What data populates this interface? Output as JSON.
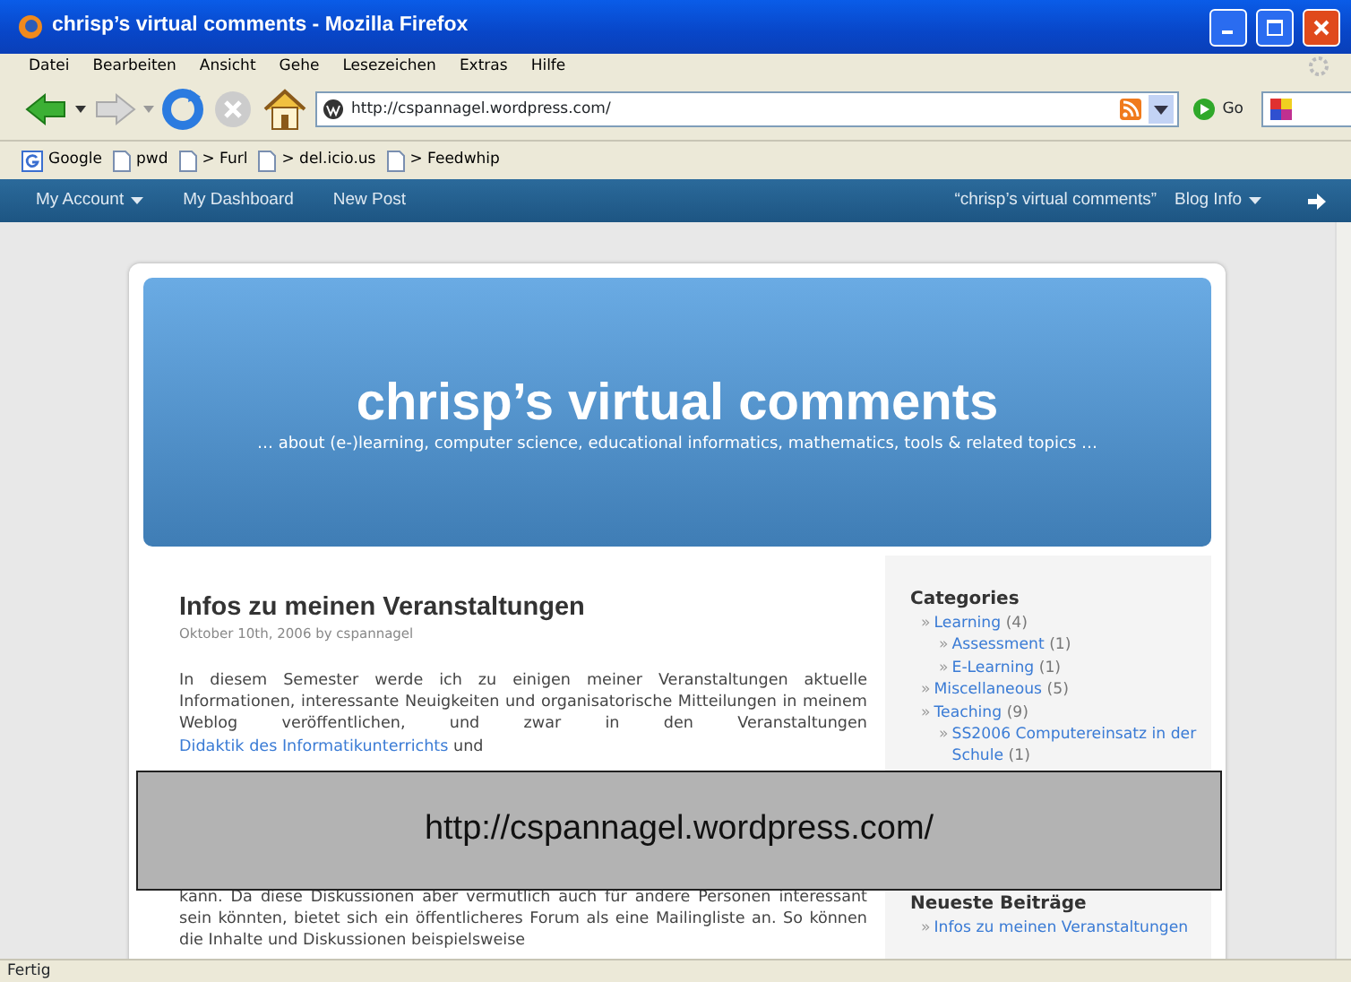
{
  "window": {
    "title": "chrisp’s virtual comments - Mozilla Firefox"
  },
  "menu": [
    "Datei",
    "Bearbeiten",
    "Ansicht",
    "Gehe",
    "Lesezeichen",
    "Extras",
    "Hilfe"
  ],
  "navigation": {
    "address": "http://cspannagel.wordpress.com/",
    "go_label": "Go"
  },
  "bookmarks": [
    {
      "label": "Google",
      "kind": "google"
    },
    {
      "label": "pwd",
      "kind": "page"
    },
    {
      "label": "> Furl",
      "kind": "page"
    },
    {
      "label": "> del.icio.us",
      "kind": "page"
    },
    {
      "label": "> Feedwhip",
      "kind": "page"
    }
  ],
  "admin_bar": {
    "left": [
      {
        "label": "My Account",
        "has_menu": true
      },
      {
        "label": "My Dashboard",
        "has_menu": false
      },
      {
        "label": "New Post",
        "has_menu": false
      }
    ],
    "right": [
      {
        "label": "“chrisp’s virtual comments”",
        "has_menu": false
      },
      {
        "label": "Blog Info",
        "has_menu": true
      }
    ]
  },
  "blog": {
    "title": "chrisp’s virtual comments",
    "tagline": "… about (e-)learning, computer science, educational informatics, mathematics, tools & related topics …"
  },
  "post": {
    "title": "Infos zu meinen Veranstaltungen",
    "meta": "Oktober 10th, 2006 by cspannagel",
    "paragraph_top": {
      "before": "In diesem Semester werde ich zu einigen meiner Veranstaltungen aktuelle Informationen, interessante Neuigkeiten und organisatorische Mitteilungen in meinem Weblog veröffentlichen, und zwar in den Veranstaltungen ",
      "link": "Didaktik des Informatikunterrichts",
      "after": " und"
    },
    "paragraph_bottom": "kann. Da diese Diskussionen aber vermutlich auch für andere Personen interessant sein könnten, bietet sich ein öffentlicheres Forum als eine Mailingliste an. So können die Inhalte und Diskussionen beispielsweise"
  },
  "sidebar": {
    "categories_title": "Categories",
    "categories": [
      {
        "bullet": "»",
        "label": "Learning",
        "count": "(4)",
        "children": [
          {
            "bullet": "»",
            "label": "Assessment",
            "count": "(1)"
          },
          {
            "bullet": "»",
            "label": "E-Learning",
            "count": "(1)"
          }
        ]
      },
      {
        "bullet": "»",
        "label": "Miscellaneous",
        "count": "(5)"
      },
      {
        "bullet": "»",
        "label": "Teaching",
        "count": "(9)",
        "children": [
          {
            "bullet": "»",
            "label": "SS2006 Computereinsatz in der Schule",
            "count": "(1)"
          }
        ]
      }
    ],
    "recent_title": "Neueste Beiträge",
    "recent": [
      {
        "bullet": "»",
        "label": "Infos zu meinen Veranstaltungen"
      }
    ]
  },
  "caption": {
    "text": "http://cspannagel.wordpress.com/"
  },
  "status_bar": {
    "text": "Fertig"
  }
}
